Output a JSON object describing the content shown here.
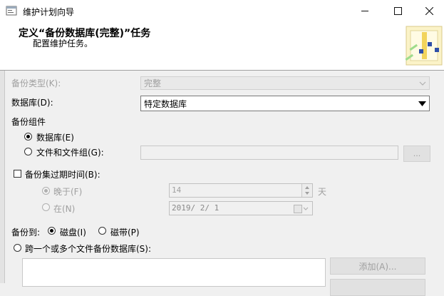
{
  "window": {
    "title": "维护计划向导"
  },
  "header": {
    "title": "定义“备份数据库(完整)”任务",
    "subtitle": "配置维护任务。"
  },
  "form": {
    "backup_type_label": "备份类型(K):",
    "backup_type_value": "完整",
    "database_label": "数据库(D):",
    "database_value": "特定数据库",
    "backup_component_label": "备份组件",
    "component_database_label": "数据库(E)",
    "component_files_label": "文件和文件组(G):",
    "browse_label": "...",
    "expire_label": "备份集过期时间(B):",
    "after_label": "晚于(F)",
    "after_value": "14",
    "days_label": "天",
    "on_label": "在(N)",
    "on_value": "2019/ 2/ 1",
    "backup_to_label": "备份到:",
    "disk_label": "磁盘(I)",
    "tape_label": "磁带(P)",
    "span_label": "跨一个或多个文件备份数据库(S):",
    "add_label": "添加(A)..."
  },
  "state": {
    "component_selected": "database",
    "expire_checked": false,
    "expire_selected": "after",
    "backup_to_selected": "disk"
  }
}
